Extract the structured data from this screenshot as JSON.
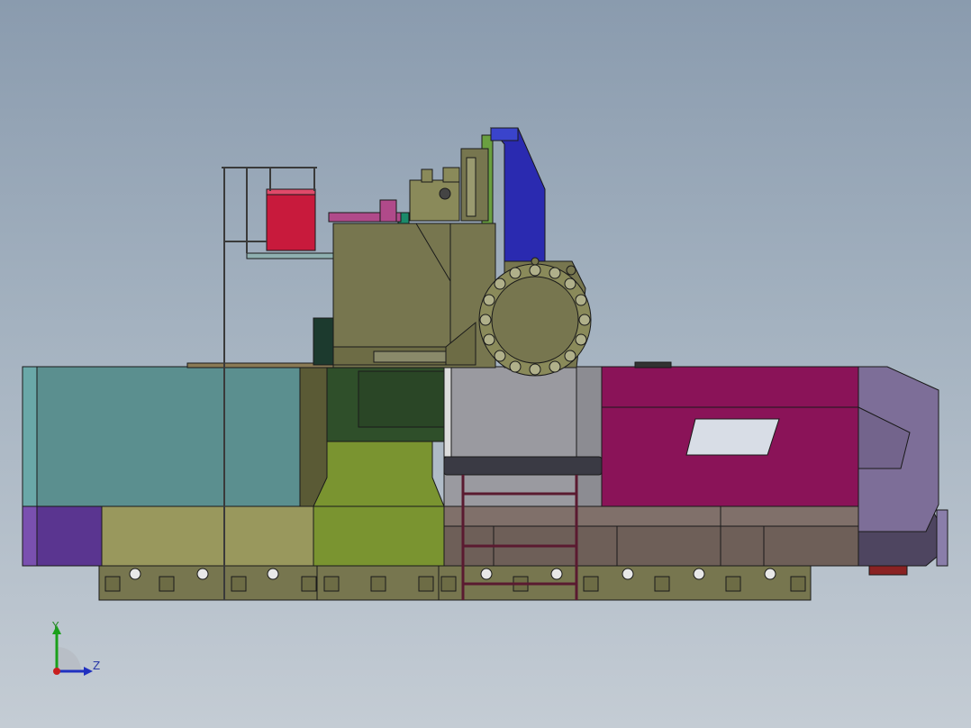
{
  "viewport": {
    "background_top": "#8a9bae",
    "background_bottom": "#c4ccd4"
  },
  "triad": {
    "y_label": "Y",
    "z_label": "Z",
    "y_color": "#1aa01a",
    "z_color": "#2030c0",
    "x_color": "#c81e1e"
  },
  "colors": {
    "olive": "#77764f",
    "teal_panel": "#5b8f8f",
    "dark_green": "#2f4f2a",
    "lime": "#7a9430",
    "light_gray": "#9a9aa0",
    "magenta": "#8a1358",
    "lavender": "#7d6e98",
    "purple": "#5a3590",
    "khaki": "#99985d",
    "brown_rail": "#6e5f58",
    "motor_blue": "#2a2ab0",
    "red_box": "#c81a3c",
    "pink_part": "#b04a8a"
  },
  "icons": [
    "coordinate-triad-icon"
  ]
}
